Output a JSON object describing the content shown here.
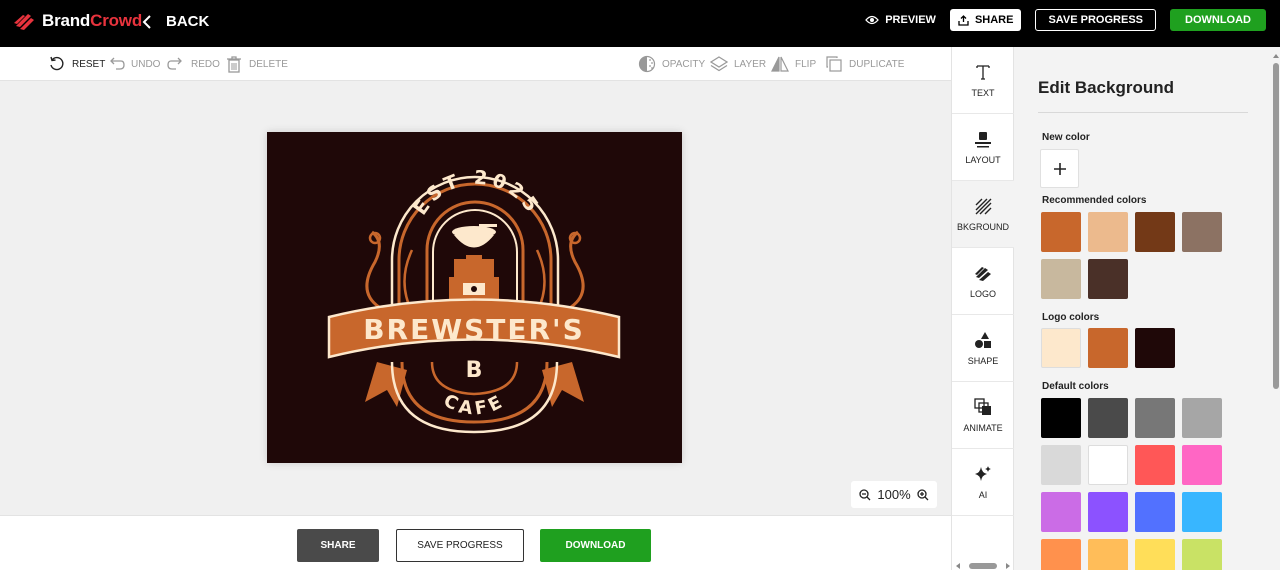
{
  "header": {
    "brand_part1": "Brand",
    "brand_part2": "Crowd",
    "back_label": "BACK",
    "preview_label": "PREVIEW",
    "share_label": "SHARE",
    "save_label": "SAVE PROGRESS",
    "download_label": "DOWNLOAD"
  },
  "toolbar": {
    "reset": "RESET",
    "undo": "UNDO",
    "redo": "REDO",
    "delete": "DELETE",
    "opacity": "OPACITY",
    "layer": "LAYER",
    "flip": "FLIP",
    "duplicate": "DUPLICATE"
  },
  "logo": {
    "arc_text": "EST 2025",
    "banner_text": "BREWSTER'S",
    "monogram": "B",
    "bottom_text": "CAFE"
  },
  "zoom": {
    "level": "100%"
  },
  "footer": {
    "share_label": "SHARE",
    "save_label": "SAVE PROGRESS",
    "download_label": "DOWNLOAD"
  },
  "sidenav": {
    "items": [
      {
        "label": "TEXT",
        "icon": "text-icon"
      },
      {
        "label": "LAYOUT",
        "icon": "layout-icon"
      },
      {
        "label": "BKGROUND",
        "icon": "background-icon"
      },
      {
        "label": "LOGO",
        "icon": "logo-icon"
      },
      {
        "label": "SHAPE",
        "icon": "shape-icon"
      },
      {
        "label": "ANIMATE",
        "icon": "animate-icon"
      },
      {
        "label": "AI",
        "icon": "ai-sparkle-icon"
      }
    ]
  },
  "panel": {
    "title": "Edit Background",
    "new_color_label": "New color",
    "recommended_label": "Recommended colors",
    "logo_colors_label": "Logo colors",
    "default_colors_label": "Default colors",
    "recommended_colors": [
      "#c8672c",
      "#ecba8d",
      "#733917",
      "#8c7263",
      "#c8b89e",
      "#4a3028"
    ],
    "logo_colors": [
      "#fde8cc",
      "#c8672c",
      "#1f0808"
    ],
    "default_colors": [
      "#000000",
      "#4a4a4a",
      "#777777",
      "#a6a6a6",
      "#d9d9d9",
      "#ffffff",
      "#ff5757",
      "#ff66c4",
      "#cb6ce6",
      "#8c52ff",
      "#5271ff",
      "#38b6ff",
      "#ff914d",
      "#ffbd59",
      "#ffde59",
      "#c9e265"
    ]
  },
  "colors": {
    "accent_green": "#1fa01f",
    "brand_red": "#e8333d",
    "artboard_bg": "#1f0808",
    "logo_orange": "#c8672c",
    "logo_cream": "#fde8cc"
  }
}
